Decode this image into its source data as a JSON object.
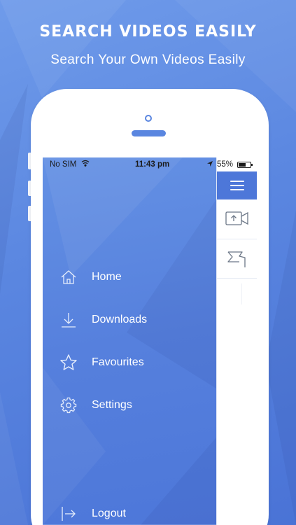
{
  "promo": {
    "title": "Search Videos Easily",
    "subtitle": "Search Your Own Videos Easily"
  },
  "status_bar": {
    "carrier": "No SIM",
    "time": "11:43 pm",
    "battery": "55%"
  },
  "menu": {
    "items": [
      {
        "label": "Home",
        "icon": "home-icon"
      },
      {
        "label": "Downloads",
        "icon": "download-icon"
      },
      {
        "label": "Favourites",
        "icon": "star-icon"
      },
      {
        "label": "Settings",
        "icon": "gear-icon"
      },
      {
        "label": "Logout",
        "icon": "logout-icon"
      }
    ]
  },
  "colors": {
    "background": "#5a86e0",
    "drawer": "#5680dd",
    "nav_header": "#4d77d9",
    "phone": "#ffffff"
  }
}
